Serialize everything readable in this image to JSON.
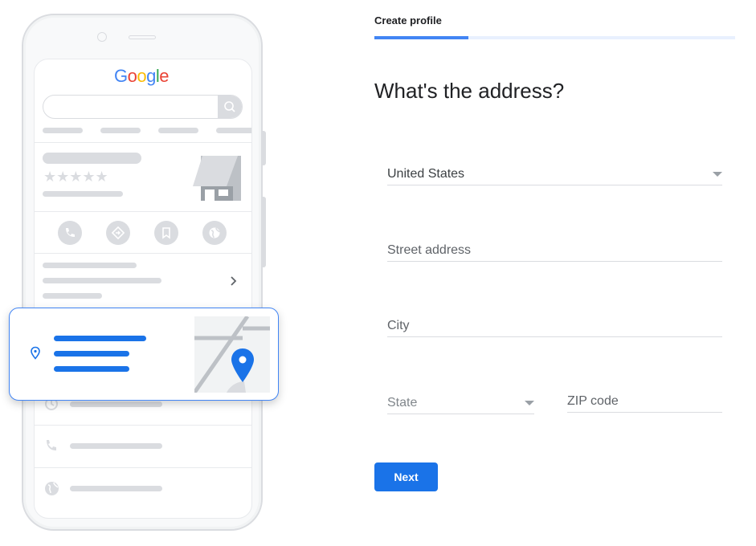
{
  "illustration": {
    "logo_text": "Google"
  },
  "header": {
    "step_label": "Create profile",
    "progress_percent": 26,
    "accent": "#4285f4",
    "track": "#e8f0fe"
  },
  "main": {
    "title": "What's the address?",
    "fields": {
      "country": {
        "value": "United States",
        "type": "select"
      },
      "street": {
        "placeholder": "Street address"
      },
      "city": {
        "placeholder": "City"
      },
      "state": {
        "placeholder": "State",
        "type": "select"
      },
      "zip": {
        "placeholder": "ZIP code"
      }
    },
    "next_label": "Next",
    "button_color": "#1a73e8"
  }
}
